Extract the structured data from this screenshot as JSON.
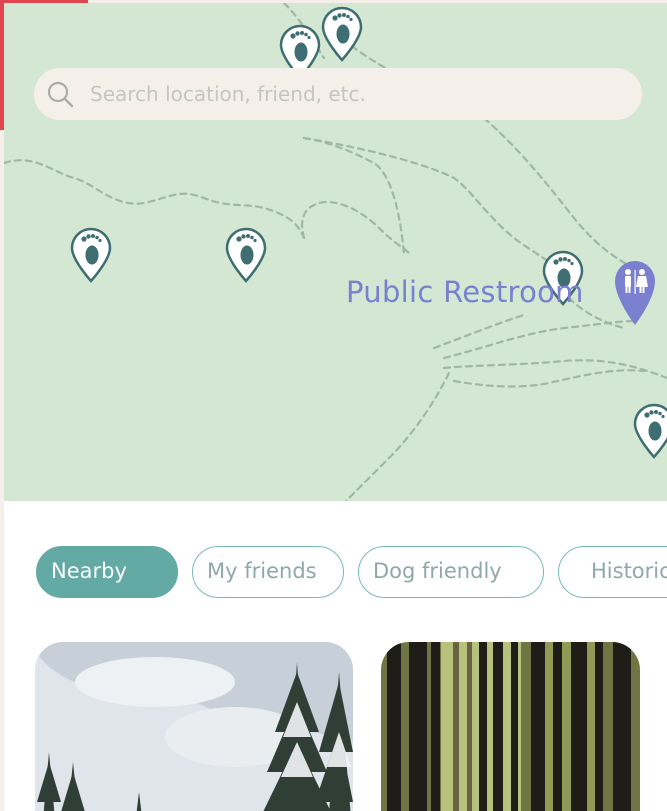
{
  "colors": {
    "accent_red": "#e0464f",
    "map_bg": "#d3e7d3",
    "trail": "#9fb8a3",
    "pin": "#3f6e72",
    "poi": "#7a80cf",
    "chip_teal": "#62aaa3",
    "search_bg": "#f4efe9"
  },
  "search": {
    "placeholder": "Search location, friend, etc.",
    "icon": "search-icon"
  },
  "map": {
    "poi_label": "Public Restroom",
    "poi_icon": "restroom-icon",
    "pin_icon": "footprint-pin-icon"
  },
  "filters": [
    {
      "label": "Nearby",
      "active": true
    },
    {
      "label": "My friends",
      "active": false
    },
    {
      "label": "Dog friendly",
      "active": false
    },
    {
      "label": "Historic",
      "active": false
    }
  ],
  "cards": [
    {
      "image": "snowy-pine-trees-photo"
    },
    {
      "image": "forest-trunks-photo"
    }
  ]
}
